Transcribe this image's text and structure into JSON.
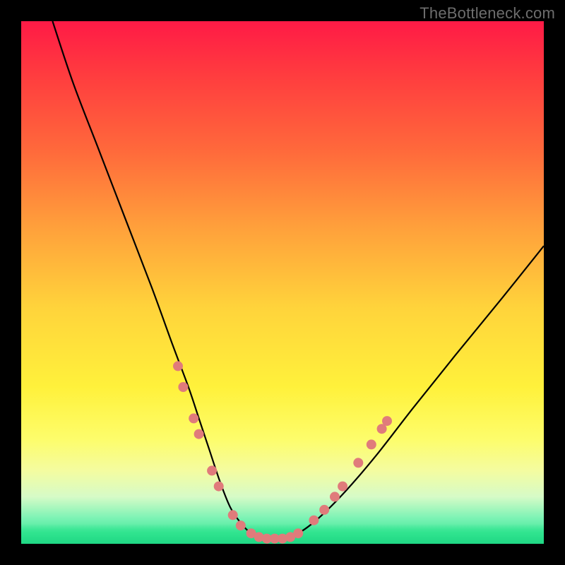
{
  "watermark": "TheBottleneck.com",
  "chart_data": {
    "type": "line",
    "title": "",
    "xlabel": "",
    "ylabel": "",
    "xlim": [
      0,
      100
    ],
    "ylim": [
      0,
      100
    ],
    "grid": false,
    "legend": false,
    "series": [
      {
        "name": "bottleneck-curve",
        "x": [
          6,
          10,
          15,
          20,
          25,
          29,
          32,
          34,
          36,
          38,
          40,
          42,
          44,
          46,
          48,
          50,
          53,
          57,
          62,
          68,
          75,
          83,
          92,
          100
        ],
        "y": [
          100,
          88,
          75,
          62,
          49,
          38,
          30,
          24,
          18,
          12,
          7,
          4,
          2,
          1,
          1,
          1,
          2,
          5,
          10,
          17,
          26,
          36,
          47,
          57
        ]
      }
    ],
    "markers": {
      "name": "highlight-dots",
      "color": "#e07b7b",
      "points": [
        {
          "x": 30.0,
          "y": 34
        },
        {
          "x": 31.0,
          "y": 30
        },
        {
          "x": 33.0,
          "y": 24
        },
        {
          "x": 34.0,
          "y": 21
        },
        {
          "x": 36.5,
          "y": 14
        },
        {
          "x": 37.8,
          "y": 11
        },
        {
          "x": 40.5,
          "y": 5.5
        },
        {
          "x": 42.0,
          "y": 3.5
        },
        {
          "x": 44.0,
          "y": 2.0
        },
        {
          "x": 45.5,
          "y": 1.3
        },
        {
          "x": 47.0,
          "y": 1.0
        },
        {
          "x": 48.5,
          "y": 1.0
        },
        {
          "x": 50.0,
          "y": 1.0
        },
        {
          "x": 51.5,
          "y": 1.3
        },
        {
          "x": 53.0,
          "y": 2.0
        },
        {
          "x": 56.0,
          "y": 4.5
        },
        {
          "x": 58.0,
          "y": 6.5
        },
        {
          "x": 60.0,
          "y": 9.0
        },
        {
          "x": 61.5,
          "y": 11.0
        },
        {
          "x": 64.5,
          "y": 15.5
        },
        {
          "x": 67.0,
          "y": 19.0
        },
        {
          "x": 69.0,
          "y": 22.0
        },
        {
          "x": 70.0,
          "y": 23.5
        }
      ]
    },
    "gradient_colors": {
      "top": "#ff1a46",
      "mid": "#fff13b",
      "bottom": "#21e28b"
    }
  }
}
